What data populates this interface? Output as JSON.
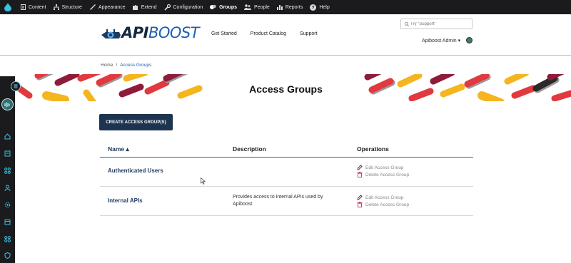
{
  "admin_toolbar": {
    "items": [
      {
        "label": "Content",
        "icon": "document-icon"
      },
      {
        "label": "Structure",
        "icon": "structure-icon"
      },
      {
        "label": "Appearance",
        "icon": "brush-icon"
      },
      {
        "label": "Extend",
        "icon": "puzzle-icon"
      },
      {
        "label": "Configuration",
        "icon": "wrench-icon"
      },
      {
        "label": "Groups",
        "icon": "groups-icon",
        "active": true
      },
      {
        "label": "People",
        "icon": "people-icon"
      },
      {
        "label": "Reports",
        "icon": "reports-icon"
      },
      {
        "label": "Help",
        "icon": "help-icon"
      }
    ]
  },
  "header": {
    "logo_api": "API",
    "logo_boost": "BOOST",
    "nav": [
      "Get Started",
      "Product Catalog",
      "Support"
    ],
    "search_placeholder": "Try \"Support\"",
    "user_menu": "Apiboost Admin ▾"
  },
  "breadcrumb": {
    "home": "Home",
    "separator": "/",
    "current": "Access Groups"
  },
  "page": {
    "title": "Access Groups",
    "create_button": "CREATE ACCESS GROUP(S)"
  },
  "table": {
    "columns": {
      "name": "Name ▴",
      "description": "Description",
      "operations": "Operations"
    },
    "rows": [
      {
        "name": "Authenticated Users",
        "description": "",
        "edit": "Edit Access Group",
        "delete": "Delete Access Group"
      },
      {
        "name": "Internal APIs",
        "description": "Provides access to internal APIs used by Apiboost.",
        "edit": "Edit Access Group",
        "delete": "Delete Access Group"
      }
    ]
  },
  "colors": {
    "toolbar_bg": "#1b1b1d",
    "brand_navy": "#1d3450",
    "link_blue": "#1d3a5f",
    "delete_red": "#d42a4a",
    "banner_red": "#e1393f",
    "banner_yellow": "#f5b51f",
    "banner_maroon": "#8e1b3a"
  }
}
